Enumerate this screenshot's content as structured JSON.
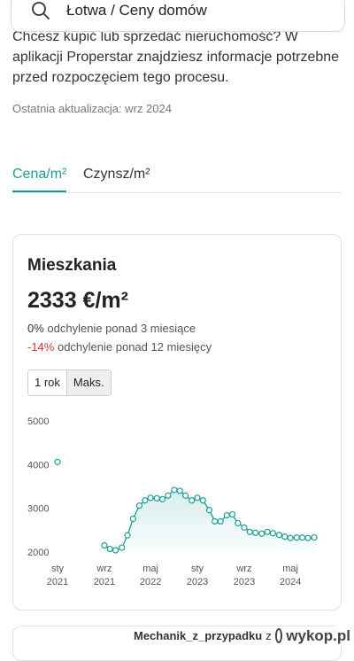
{
  "search": {
    "value": "Łotwa / Ceny domów"
  },
  "intro_text": "Chcesz kupić lub sprzedać nieruchomość? W aplikacji Properstar znajdziesz informacje potrzebne przed rozpoczęciem tego procesu.",
  "last_update": "Ostatnia aktualizacja: wrz 2024",
  "tabs": {
    "price": "Cena/m²",
    "rent": "Czynsz/m²"
  },
  "card": {
    "title": "Mieszkania",
    "price": "2333 €/m²",
    "dev3_value": "0%",
    "dev3_text": " odchylenie ponad 3 miesiące",
    "dev12_value": "-14%",
    "dev12_text": " odchylenie ponad 12 miesięcy",
    "range_buttons": [
      "1 rok",
      "Maks."
    ]
  },
  "watermark": {
    "user": "Mechanik_z_przypadku",
    "sep": "z",
    "site": "wykop.pl"
  },
  "colors": {
    "accent": "#1a9e93",
    "negative": "#d0323f"
  },
  "chart_data": {
    "type": "line",
    "ylim": [
      2000,
      5000
    ],
    "yticks": [
      5000,
      4000,
      3000,
      2000
    ],
    "xticks": [
      {
        "month": "sty",
        "year": "2021",
        "t": 2021.0
      },
      {
        "month": "wrz",
        "year": "2021",
        "t": 2021.67
      },
      {
        "month": "maj",
        "year": "2022",
        "t": 2022.33
      },
      {
        "month": "sty",
        "year": "2023",
        "t": 2023.0
      },
      {
        "month": "wrz",
        "year": "2023",
        "t": 2023.67
      },
      {
        "month": "maj",
        "year": "2024",
        "t": 2024.33
      }
    ],
    "series": [
      {
        "points": [
          {
            "t": 2021.0,
            "y": 4060
          },
          {
            "t": 2021.67,
            "y": 2150
          },
          {
            "t": 2021.75,
            "y": 2070
          },
          {
            "t": 2021.83,
            "y": 2040
          },
          {
            "t": 2021.92,
            "y": 2100
          },
          {
            "t": 2022.0,
            "y": 2380
          },
          {
            "t": 2022.08,
            "y": 2760
          },
          {
            "t": 2022.17,
            "y": 3060
          },
          {
            "t": 2022.25,
            "y": 3180
          },
          {
            "t": 2022.33,
            "y": 3240
          },
          {
            "t": 2022.42,
            "y": 3230
          },
          {
            "t": 2022.5,
            "y": 3210
          },
          {
            "t": 2022.58,
            "y": 3290
          },
          {
            "t": 2022.67,
            "y": 3420
          },
          {
            "t": 2022.75,
            "y": 3400
          },
          {
            "t": 2022.83,
            "y": 3290
          },
          {
            "t": 2022.92,
            "y": 3180
          },
          {
            "t": 2023.0,
            "y": 3240
          },
          {
            "t": 2023.08,
            "y": 3180
          },
          {
            "t": 2023.17,
            "y": 2960
          },
          {
            "t": 2023.25,
            "y": 2700
          },
          {
            "t": 2023.33,
            "y": 2700
          },
          {
            "t": 2023.42,
            "y": 2840
          },
          {
            "t": 2023.5,
            "y": 2860
          },
          {
            "t": 2023.58,
            "y": 2660
          },
          {
            "t": 2023.67,
            "y": 2560
          },
          {
            "t": 2023.75,
            "y": 2460
          },
          {
            "t": 2023.83,
            "y": 2440
          },
          {
            "t": 2023.92,
            "y": 2420
          },
          {
            "t": 2024.0,
            "y": 2460
          },
          {
            "t": 2024.08,
            "y": 2430
          },
          {
            "t": 2024.17,
            "y": 2390
          },
          {
            "t": 2024.25,
            "y": 2350
          },
          {
            "t": 2024.33,
            "y": 2320
          },
          {
            "t": 2024.42,
            "y": 2330
          },
          {
            "t": 2024.5,
            "y": 2330
          },
          {
            "t": 2024.58,
            "y": 2320
          },
          {
            "t": 2024.67,
            "y": 2333
          }
        ]
      }
    ]
  }
}
